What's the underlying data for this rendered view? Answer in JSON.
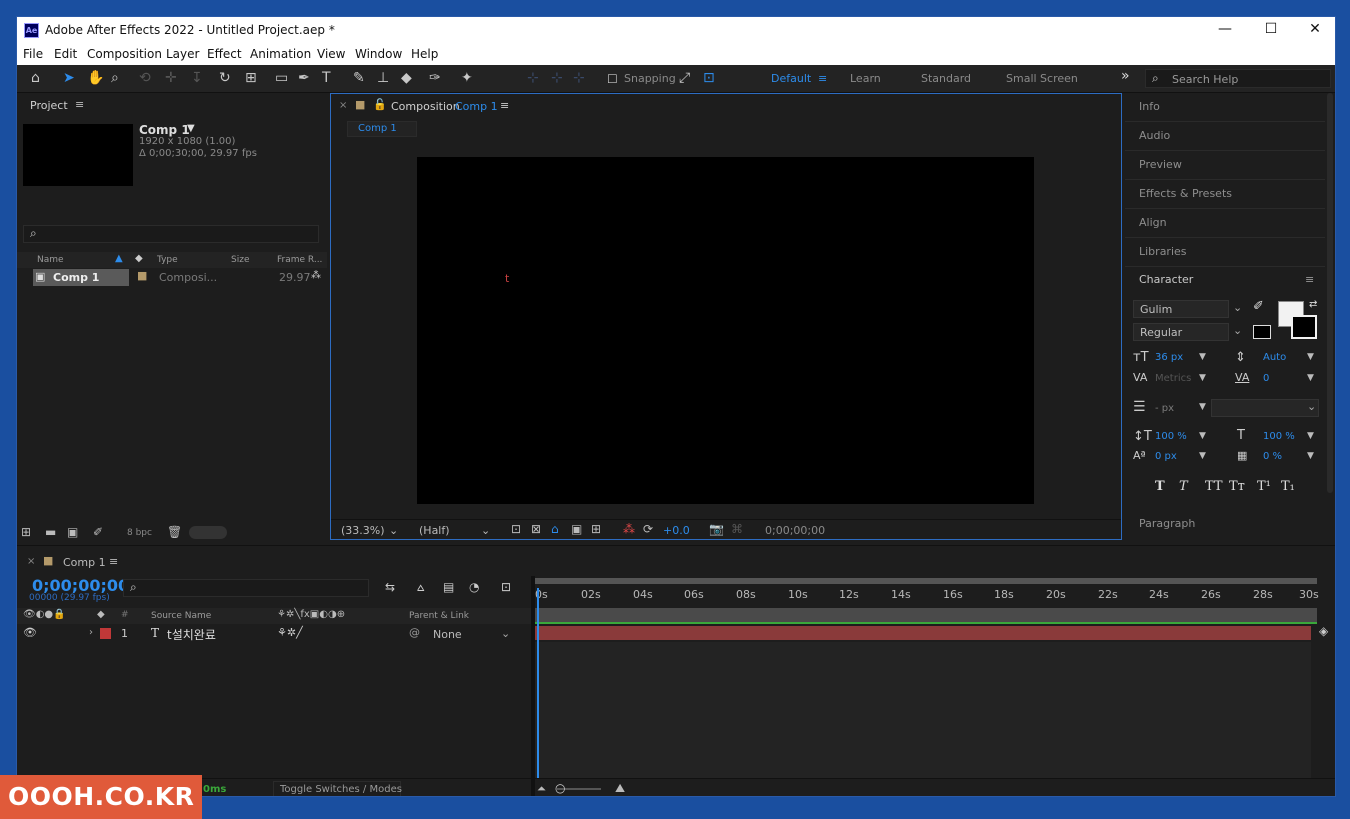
{
  "window": {
    "app_icon": "Ae",
    "title": "Adobe After Effects 2022 - Untitled Project.aep *",
    "minimize": "—",
    "maximize": "☐",
    "close": "✕"
  },
  "menu": [
    "File",
    "Edit",
    "Composition",
    "Layer",
    "Effect",
    "Animation",
    "View",
    "Window",
    "Help"
  ],
  "toolbar": {
    "snapping_label": "Snapping",
    "workspaces": [
      "Default",
      "Learn",
      "Standard",
      "Small Screen"
    ],
    "active_workspace": "Default",
    "overflow": "»",
    "search_placeholder": "Search Help"
  },
  "project_panel": {
    "title": "Project",
    "comp_name": "Comp 1",
    "comp_resolution": "1920 x 1080 (1.00)",
    "comp_duration": "Δ 0;00;30;00, 29.97 fps",
    "search_icon": "⌕",
    "columns": [
      "Name",
      "Type",
      "Size",
      "Frame R..."
    ],
    "rows": [
      {
        "name": "Comp 1",
        "type": "Composi...",
        "size": "",
        "frame_rate": "29.97"
      }
    ],
    "bpc": "8 bpc"
  },
  "composition_panel": {
    "title": "Composition",
    "comp_link": "Comp 1",
    "tab": "Comp 1",
    "cursor_text": "t",
    "zoom": "(33.3%)",
    "resolution": "(Half)",
    "exposure": "+0.0",
    "timecode": "0;00;00;00"
  },
  "right_panels": [
    "Info",
    "Audio",
    "Preview",
    "Effects & Presets",
    "Align",
    "Libraries"
  ],
  "character": {
    "title": "Character",
    "font": "Gulim",
    "style": "Regular",
    "font_size": "36 px",
    "leading": "Auto",
    "kerning": "Metrics",
    "tracking": "0",
    "stroke": "- px",
    "vscale": "100 %",
    "hscale": "100 %",
    "baseline": "0 px",
    "tsume": "0 %",
    "style_buttons": [
      "T",
      "T",
      "TT",
      "Tт",
      "T¹",
      "T₁"
    ],
    "fill_color": "#f2f2f2",
    "stroke_color": "#000000"
  },
  "paragraph": {
    "title": "Paragraph"
  },
  "timeline": {
    "tab": "Comp 1",
    "timecode": "0;00;00;00",
    "frame_info": "00000 (29.97 fps)",
    "headers": {
      "source_name": "Source Name",
      "parent": "Parent & Link",
      "num": "#"
    },
    "ruler": [
      "0s",
      "02s",
      "04s",
      "06s",
      "08s",
      "10s",
      "12s",
      "14s",
      "16s",
      "18s",
      "20s",
      "22s",
      "24s",
      "26s",
      "28s",
      "30s"
    ],
    "layers": [
      {
        "index": "1",
        "type_icon": "T",
        "name": "t설치완료",
        "parent": "None"
      }
    ],
    "frame_render": "0ms",
    "toggle_label": "Toggle Switches / Modes"
  },
  "watermark": "OOOH.CO.KR"
}
